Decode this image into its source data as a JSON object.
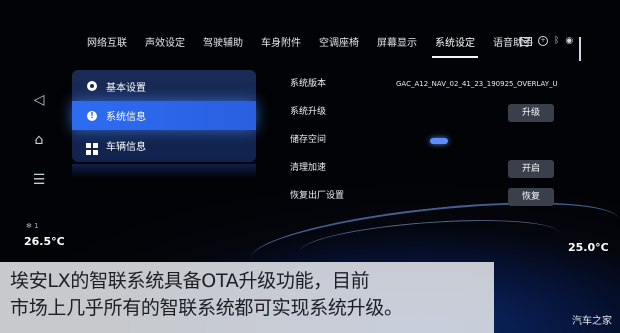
{
  "tabs": [
    {
      "label": "网络互联"
    },
    {
      "label": "声效设定"
    },
    {
      "label": "驾驶辅助"
    },
    {
      "label": "车身附件"
    },
    {
      "label": "空调座椅"
    },
    {
      "label": "屏幕显示"
    },
    {
      "label": "系统设定"
    },
    {
      "label": "语音助手"
    }
  ],
  "active_tab_index": 6,
  "status_icons": [
    "mail-icon",
    "circle-icon",
    "bluetooth-icon",
    "location-icon",
    "signal-icon"
  ],
  "nav_icons": [
    "back-icon",
    "home-icon",
    "menu-icon"
  ],
  "menu": {
    "items": [
      {
        "label": "基本设置",
        "icon": "gear-icon"
      },
      {
        "label": "系统信息",
        "icon": "info-icon"
      },
      {
        "label": "车辆信息",
        "icon": "grid-icon"
      }
    ],
    "selected_index": 1
  },
  "settings": {
    "version_label": "系统版本",
    "version_value": "GAC_A12_NAV_02_41_23_190925_OVERLAY_U",
    "upgrade_label": "系统升级",
    "upgrade_button": "升级",
    "storage_label": "储存空间",
    "cleanup_label": "清理加速",
    "cleanup_button": "开启",
    "reset_label": "恢复出厂设置",
    "reset_button": "恢复"
  },
  "climate": {
    "left_fan": "1",
    "left_temp": "26.5°C",
    "right_temp": "25.0°C"
  },
  "caption": {
    "line1": "埃安LX的智联系统具备OTA升级功能，目前",
    "line2": "市场上几乎所有的智联系统都可实现系统升级。"
  },
  "watermark": "汽车之家",
  "colors": {
    "accent": "#2d6cf2",
    "background": "#04060d",
    "button": "#3a3f4c"
  }
}
